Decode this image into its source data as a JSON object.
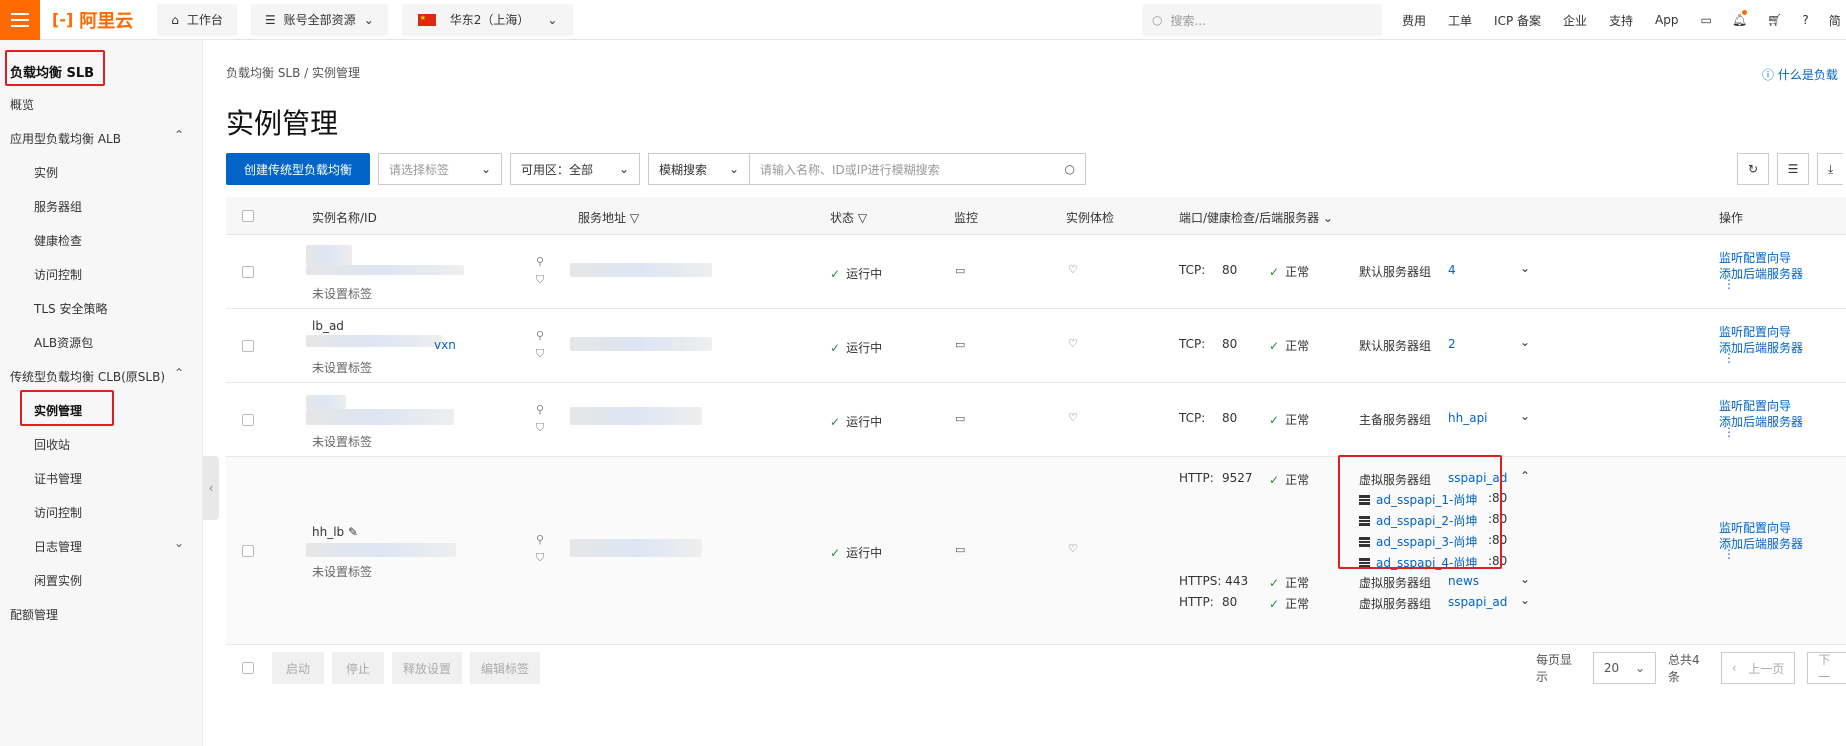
{
  "topbar": {
    "logo": "阿里云",
    "workbench": "工作台",
    "resources": "账号全部资源",
    "region": "华东2（上海）",
    "search_placeholder": "搜索...",
    "links": [
      "费用",
      "工单",
      "ICP 备案",
      "企业",
      "支持",
      "App"
    ],
    "accent": "#ff6a00"
  },
  "sidebar": {
    "title": "负载均衡 SLB",
    "overview": "概览",
    "alb_group": "应用型负载均衡 ALB",
    "alb_items": [
      "实例",
      "服务器组",
      "健康检查",
      "访问控制",
      "TLS 安全策略",
      "ALB资源包"
    ],
    "clb_group": "传统型负载均衡 CLB(原SLB)",
    "clb_items": [
      "实例管理",
      "回收站",
      "证书管理",
      "访问控制",
      "日志管理",
      "闲置实例"
    ],
    "quota": "配额管理"
  },
  "main": {
    "breadcrumb": "负载均衡 SLB  /  实例管理",
    "title": "实例管理",
    "help": "什么是负载",
    "create_button": "创建传统型负载均衡",
    "tag_placeholder": "请选择标签",
    "zone_label": "可用区：全部",
    "fuzzy_label": "模糊搜索",
    "search_placeholder": "请输入名称、ID或IP进行模糊搜索",
    "primary_color": "#0064c8"
  },
  "table": {
    "headers": {
      "name": "实例名称/ID",
      "address": "服务地址",
      "status": "状态",
      "monitor": "监控",
      "check": "实例体检",
      "ports": "端口/健康检查/后端服务器",
      "action": "操作"
    },
    "rows": [
      {
        "name": "",
        "id_suffix": "",
        "tag": "未设置标签",
        "status": "运行中",
        "protocol": "TCP:",
        "port": "80",
        "health": "正常",
        "group_type": "默认服务器组",
        "group_value": "4"
      },
      {
        "name": "lb_ad",
        "id_suffix": "vxn",
        "tag": "未设置标签",
        "status": "运行中",
        "protocol": "TCP:",
        "port": "80",
        "health": "正常",
        "group_type": "默认服务器组",
        "group_value": "2"
      },
      {
        "name": "",
        "id_suffix": "",
        "tag": "未设置标签",
        "status": "运行中",
        "protocol": "TCP:",
        "port": "80",
        "health": "正常",
        "group_type": "主备服务器组",
        "group_value": "hh_api"
      }
    ],
    "row4": {
      "name": "hh_lb",
      "tag": "未设置标签",
      "status": "运行中",
      "l1": {
        "protocol": "HTTP:",
        "port": "9527",
        "health": "正常",
        "group_type": "虚拟服务器组",
        "group_value": "sspapi_ad"
      },
      "servers": [
        {
          "name": "ad_sspapi_1-尚坤",
          "port": ":80"
        },
        {
          "name": "ad_sspapi_2-尚坤",
          "port": ":80"
        },
        {
          "name": "ad_sspapi_3-尚坤",
          "port": ":80"
        },
        {
          "name": "ad_sspapi_4-尚坤",
          "port": ":80"
        }
      ],
      "l2": {
        "protocol": "HTTPS: 443",
        "health": "正常",
        "group_type": "虚拟服务器组",
        "group_value": "news"
      },
      "l3": {
        "protocol": "HTTP:",
        "port": "80",
        "health": "正常",
        "group_type": "虚拟服务器组",
        "group_value": "sspapi_ad"
      }
    },
    "action1": "监听配置向导",
    "action2": "添加后端服务器"
  },
  "footer": {
    "buttons": [
      "启动",
      "停止",
      "释放设置",
      "编辑标签"
    ],
    "per_page_label": "每页显示",
    "per_page": "20",
    "total": "总共4条",
    "prev": "上一页",
    "next": "下一"
  }
}
